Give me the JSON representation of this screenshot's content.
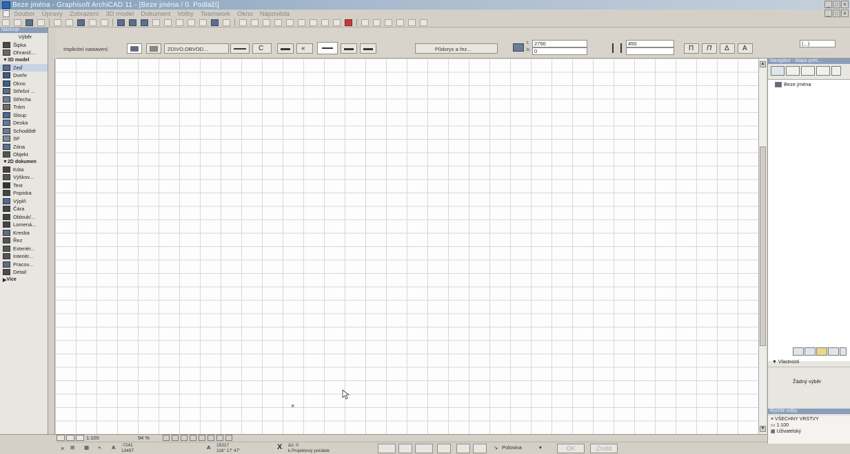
{
  "window": {
    "title": "Beze jména - Graphisoft ArchiCAD 11 - [Beze jména / 0. Podlaží]"
  },
  "menu": [
    "Soubor",
    "Úpravy",
    "Zobrazení",
    "3D model",
    "Dokument",
    "Volby",
    "Teamwork",
    "Okno",
    "Nápověda"
  ],
  "info_box": {
    "settings_label": "Implicitní nastavení",
    "wall_profile": "ZDIVO,OBVOD...",
    "view_button": "Půdorys a řez...",
    "height_value": "2750",
    "base_value": "0",
    "thickness_value": "450",
    "thickness_placeholder": "",
    "height_letter": "t:",
    "base_letter": "b:",
    "right_field": "(...)"
  },
  "toolbox": {
    "header": "Nástroje",
    "items": [
      {
        "label": "Výběr",
        "kind": "title",
        "color": "#ffffff"
      },
      {
        "label": "Šipka",
        "icon": "arrow-icon",
        "color": "#4a4a4a"
      },
      {
        "label": "Ohranič...",
        "icon": "marquee-icon",
        "color": "#6a6a6a"
      },
      {
        "label": "3D model",
        "kind": "group"
      },
      {
        "label": "Zeď",
        "icon": "wall-icon",
        "selected": true,
        "color": "#5d6c84"
      },
      {
        "label": "Dveře",
        "icon": "door-icon",
        "color": "#3c5a8c"
      },
      {
        "label": "Okno",
        "icon": "window-icon",
        "color": "#3d5f8f"
      },
      {
        "label": "Střešní ...",
        "icon": "roof-window-icon",
        "color": "#5a6f8e"
      },
      {
        "label": "Střecha",
        "icon": "roof-icon",
        "color": "#6b7f9d"
      },
      {
        "label": "Trám",
        "icon": "beam-icon",
        "color": "#6d6d6d"
      },
      {
        "label": "Sloup",
        "icon": "column-icon",
        "color": "#4e6a95"
      },
      {
        "label": "Deska",
        "icon": "slab-icon",
        "color": "#5e7aa5"
      },
      {
        "label": "Schodiště",
        "icon": "stair-icon",
        "color": "#6a7a92"
      },
      {
        "label": "SF",
        "icon": "mesh-icon",
        "color": "#7a8da8"
      },
      {
        "label": "Zóna",
        "icon": "zone-icon",
        "color": "#5b7396"
      },
      {
        "label": "Objekt",
        "icon": "object-icon",
        "color": "#555555"
      },
      {
        "label": "2D dokumen",
        "kind": "group"
      },
      {
        "label": "Kóta",
        "icon": "dimension-icon",
        "color": "#444444"
      },
      {
        "label": "Výškov...",
        "icon": "level-dimension-icon",
        "color": "#555555"
      },
      {
        "label": "Text",
        "icon": "text-icon",
        "color": "#333333"
      },
      {
        "label": "Popiska",
        "icon": "label-icon",
        "color": "#444444"
      },
      {
        "label": "Výplň",
        "icon": "fill-icon",
        "color": "#4d6a96"
      },
      {
        "label": "Čára",
        "icon": "line-icon",
        "color": "#444444"
      },
      {
        "label": "Oblouk/...",
        "icon": "arc-icon",
        "color": "#444444"
      },
      {
        "label": "Lomená...",
        "icon": "polyline-icon",
        "color": "#444444"
      },
      {
        "label": "Kresba",
        "icon": "drawing-icon",
        "color": "#5a6e8c"
      },
      {
        "label": "Řez",
        "icon": "section-icon",
        "color": "#555555"
      },
      {
        "label": "Exteriér...",
        "icon": "elevation-icon",
        "color": "#555555"
      },
      {
        "label": "Interiér...",
        "icon": "interior-elevation-icon",
        "color": "#555555"
      },
      {
        "label": "Pracov...",
        "icon": "worksheet-icon",
        "color": "#5a6e8c"
      },
      {
        "label": "Detail",
        "icon": "detail-icon",
        "color": "#4d4d4d"
      },
      {
        "label": "Více",
        "kind": "group"
      }
    ]
  },
  "navigator": {
    "header": "Navigátor - Mapa pohl...",
    "tree_item": "Beze jména"
  },
  "properties": {
    "header": "Vlastnosti",
    "empty_text": "Žádný výběr"
  },
  "quick_options": {
    "header": "Rychlé volby",
    "rows": [
      "VŠECHNY VRSTVY",
      "1:100",
      "Uživatelský"
    ]
  },
  "status": {
    "scale": "1:100",
    "zoom": "94 %",
    "coord_dx": "-7241",
    "coord_dy": "13497",
    "coord_a": "15317",
    "coord_angle": "118° 17' 47\"",
    "dist_label": "Δz: 0",
    "dist_sub": "k Projektový počátek",
    "half_label": "Polovina",
    "ok": "OK",
    "cancel": "Zrušit"
  }
}
